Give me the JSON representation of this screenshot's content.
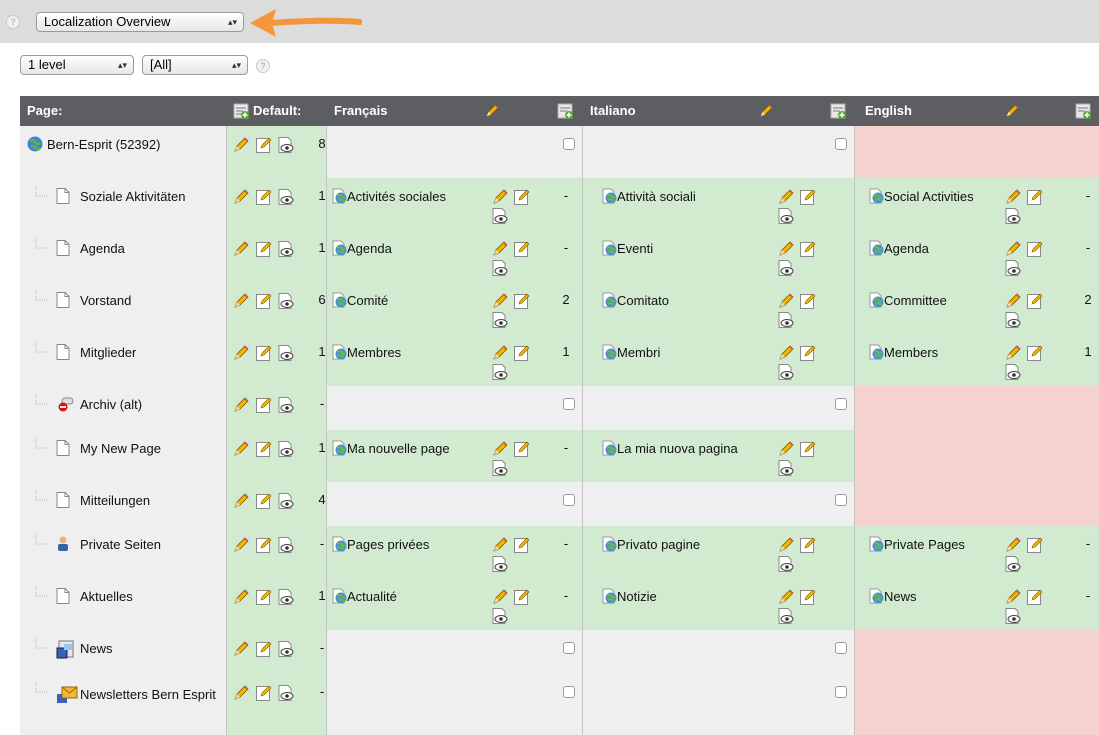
{
  "topbar": {
    "function_select": "Localization Overview"
  },
  "filters": {
    "depth_select": "1 level",
    "language_select": "[All]"
  },
  "table": {
    "headers": {
      "page": "Page:",
      "default": "Default:",
      "french": "Français",
      "italian": "Italiano",
      "english": "English"
    },
    "rows": [
      {
        "page": "Bern-Esprit (52392)",
        "icon": "globe-icon",
        "default_count": "8",
        "fr": null,
        "it": null,
        "en": null
      },
      {
        "page": "Soziale Aktivitäten",
        "icon": "page-icon",
        "default_count": "1",
        "fr": {
          "title": "Activités sociales",
          "count": "-"
        },
        "it": {
          "title": "Attività sociali",
          "count": "-"
        },
        "en": {
          "title": "Social Activities",
          "count": "-"
        }
      },
      {
        "page": "Agenda",
        "icon": "page-icon",
        "default_count": "1",
        "fr": {
          "title": "Agenda",
          "count": "-"
        },
        "it": {
          "title": "Eventi",
          "count": "-"
        },
        "en": {
          "title": "Agenda",
          "count": "-"
        }
      },
      {
        "page": "Vorstand",
        "icon": "page-icon",
        "default_count": "6",
        "fr": {
          "title": "Comité",
          "count": "2"
        },
        "it": {
          "title": "Comitato",
          "count": "2"
        },
        "en": {
          "title": "Committee",
          "count": "2"
        }
      },
      {
        "page": "Mitglieder",
        "icon": "page-icon",
        "default_count": "1",
        "fr": {
          "title": "Membres",
          "count": "1"
        },
        "it": {
          "title": "Membri",
          "count": "1"
        },
        "en": {
          "title": "Members",
          "count": "1"
        }
      },
      {
        "page": "Archiv (alt)",
        "icon": "restricted-page-icon",
        "default_count": "-",
        "fr": null,
        "it": null,
        "en": null
      },
      {
        "page": "My New Page",
        "icon": "page-icon",
        "default_count": "1",
        "fr": {
          "title": "Ma nouvelle page",
          "count": "-"
        },
        "it": {
          "title": "La mia nuova pagina",
          "count": "-"
        },
        "en": null
      },
      {
        "page": "Mitteilungen",
        "icon": "page-icon",
        "default_count": "4",
        "fr": null,
        "it": null,
        "en": null
      },
      {
        "page": "Private Seiten",
        "icon": "user-page-icon",
        "default_count": "-",
        "fr": {
          "title": "Pages privées",
          "count": "-"
        },
        "it": {
          "title": "Privato pagine",
          "count": "-"
        },
        "en": {
          "title": "Private Pages",
          "count": "-"
        }
      },
      {
        "page": "Aktuelles",
        "icon": "page-icon",
        "default_count": "1",
        "fr": {
          "title": "Actualité",
          "count": "-"
        },
        "it": {
          "title": "Notizie",
          "count": "-"
        },
        "en": {
          "title": "News",
          "count": "-"
        }
      },
      {
        "page": "News",
        "icon": "news-folder-icon",
        "default_count": "-",
        "fr": null,
        "it": null,
        "en": null
      },
      {
        "page": "Newsletters Bern Esprit",
        "icon": "newsletter-icon",
        "default_count": "-",
        "fr": null,
        "it": null,
        "en": null
      }
    ]
  }
}
